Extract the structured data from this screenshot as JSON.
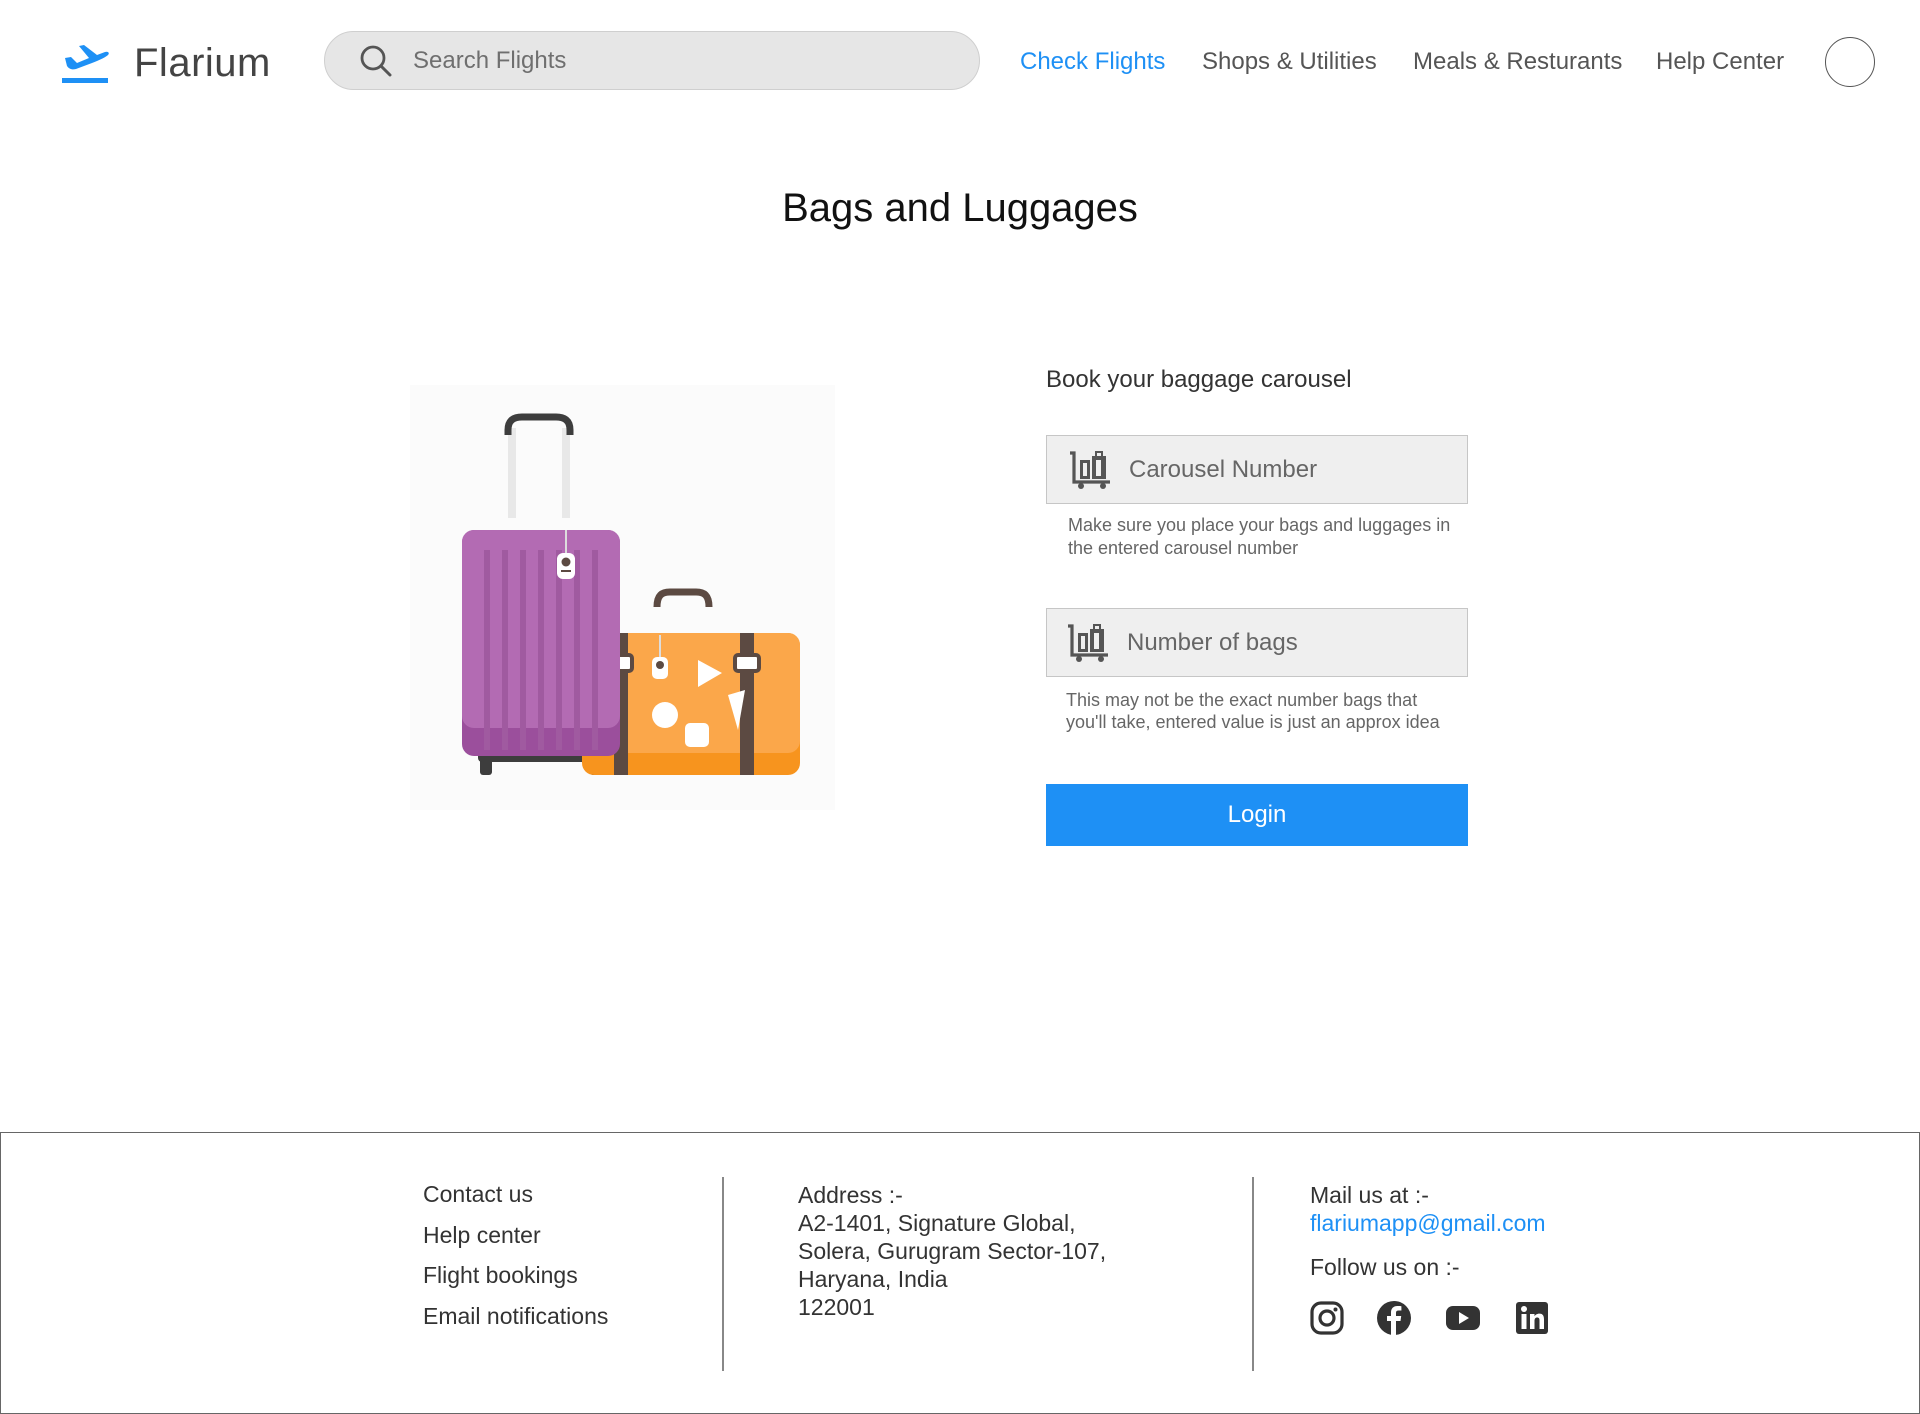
{
  "header": {
    "logo_text": "Flarium",
    "logo_icon": "airplane-takeoff-icon",
    "search_placeholder": "Search Flights",
    "nav": [
      {
        "label": "Check Flights",
        "active": true
      },
      {
        "label": "Shops & Utilities",
        "active": false
      },
      {
        "label": "Meals & Resturants",
        "active": false
      },
      {
        "label": "Help Center",
        "active": false
      }
    ],
    "avatar_icon": "user-avatar-circle"
  },
  "main": {
    "title": "Bags and Luggages",
    "illustration": "suitcases-illustration",
    "form": {
      "heading": "Book your baggage carousel",
      "carousel_placeholder": "Carousel Number",
      "carousel_hint": "Make sure you place your bags and luggages in the entered carousel number",
      "bags_placeholder": "Number of bags",
      "bags_hint": "This may not be the exact number bags that you'll take, entered value is just an approx idea",
      "submit_label": "Login",
      "field_icon": "baggage-cart-icon"
    }
  },
  "footer": {
    "links": [
      "Contact us",
      "Help center",
      "Flight bookings",
      "Email notifications"
    ],
    "address_label": "Address :-",
    "address_lines": [
      "A2-1401, Signature Global,",
      "Solera, Gurugram Sector-107,",
      "Haryana, India",
      "122001"
    ],
    "mail_label": "Mail us at :-",
    "mail_address": "flariumapp@gmail.com",
    "follow_label": "Follow us on :-",
    "socials": [
      "instagram-icon",
      "facebook-icon",
      "youtube-icon",
      "linkedin-icon"
    ]
  },
  "colors": {
    "accent": "#1e90f5",
    "text": "#333333",
    "muted": "#666666",
    "field_bg": "#efefef"
  }
}
